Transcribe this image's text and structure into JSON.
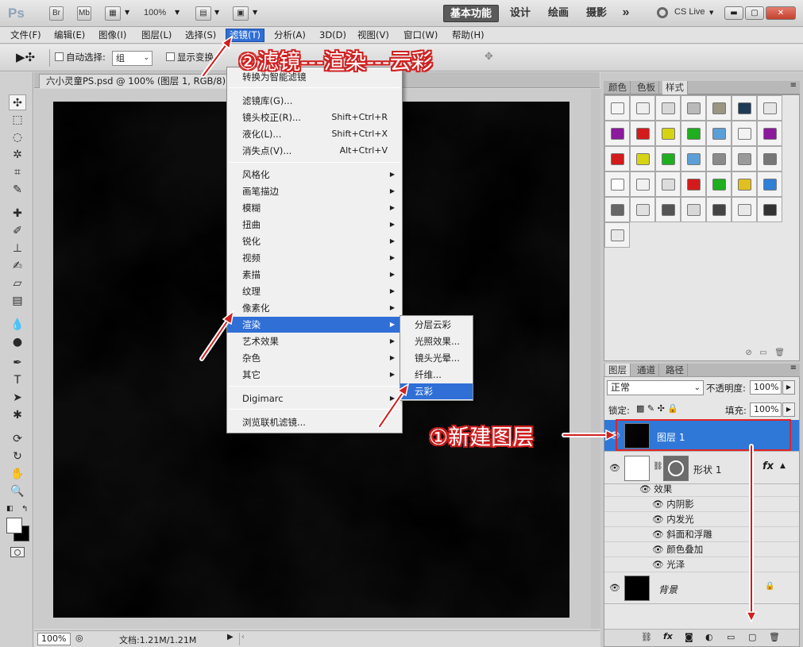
{
  "appbar": {
    "logo": "Ps",
    "bridge_label": "Br",
    "minibridge_label": "Mb",
    "zoom": "100%",
    "workspaces": [
      "基本功能",
      "设计",
      "绘画",
      "摄影"
    ],
    "more": "»",
    "cslive": "CS Live"
  },
  "menubar": {
    "items": [
      "文件(F)",
      "编辑(E)",
      "图像(I)",
      "图层(L)",
      "选择(S)",
      "滤镜(T)",
      "分析(A)",
      "3D(D)",
      "视图(V)",
      "窗口(W)",
      "帮助(H)"
    ]
  },
  "options": {
    "auto_select": "自动选择:",
    "auto_select_value": "组",
    "show_transform": "显示变换"
  },
  "document": {
    "tab_title": "六小灵童PS.psd @ 100% (图层 1, RGB/8) *",
    "zoom": "100%",
    "doc_info": "文档:1.21M/1.21M"
  },
  "filter_menu": {
    "items": [
      {
        "label": "转换为智能滤镜",
        "shortcut": "",
        "arrow": false
      },
      {
        "label": "滤镜库(G)...",
        "shortcut": "",
        "arrow": false
      },
      {
        "label": "镜头校正(R)...",
        "shortcut": "Shift+Ctrl+R",
        "arrow": false
      },
      {
        "label": "液化(L)...",
        "shortcut": "Shift+Ctrl+X",
        "arrow": false
      },
      {
        "label": "消失点(V)...",
        "shortcut": "Alt+Ctrl+V",
        "arrow": false
      },
      {
        "label": "风格化",
        "shortcut": "",
        "arrow": true
      },
      {
        "label": "画笔描边",
        "shortcut": "",
        "arrow": true
      },
      {
        "label": "模糊",
        "shortcut": "",
        "arrow": true
      },
      {
        "label": "扭曲",
        "shortcut": "",
        "arrow": true
      },
      {
        "label": "锐化",
        "shortcut": "",
        "arrow": true
      },
      {
        "label": "视频",
        "shortcut": "",
        "arrow": true
      },
      {
        "label": "素描",
        "shortcut": "",
        "arrow": true
      },
      {
        "label": "纹理",
        "shortcut": "",
        "arrow": true
      },
      {
        "label": "像素化",
        "shortcut": "",
        "arrow": true
      },
      {
        "label": "渲染",
        "shortcut": "",
        "arrow": true
      },
      {
        "label": "艺术效果",
        "shortcut": "",
        "arrow": true
      },
      {
        "label": "杂色",
        "shortcut": "",
        "arrow": true
      },
      {
        "label": "其它",
        "shortcut": "",
        "arrow": true
      },
      {
        "label": "Digimarc",
        "shortcut": "",
        "arrow": true
      },
      {
        "label": "浏览联机滤镜...",
        "shortcut": "",
        "arrow": false
      }
    ]
  },
  "render_submenu": {
    "items": [
      "分层云彩",
      "光照效果...",
      "镜头光晕...",
      "纤维...",
      "云彩"
    ]
  },
  "annotations": {
    "step2": "②滤镜---渲染---云彩",
    "step1": "①新建图层"
  },
  "panels": {
    "top_tabs": [
      "颜色",
      "色板",
      "样式"
    ],
    "layer_tabs": [
      "图层",
      "通道",
      "路径"
    ],
    "blend_mode": "正常",
    "opacity_label": "不透明度:",
    "opacity": "100%",
    "lock_label": "锁定:",
    "fill_label": "填充:",
    "fill": "100%"
  },
  "layers": [
    {
      "name": "图层 1",
      "selected": true
    },
    {
      "name": "形状 1",
      "selected": false
    },
    {
      "name": "背景",
      "selected": false
    }
  ],
  "effects": {
    "header": "效果",
    "items": [
      "内阴影",
      "内发光",
      "斜面和浮雕",
      "颜色叠加",
      "光泽"
    ]
  },
  "colors": {
    "accent": "#2f6fd6",
    "annotation_red": "#d02020"
  }
}
